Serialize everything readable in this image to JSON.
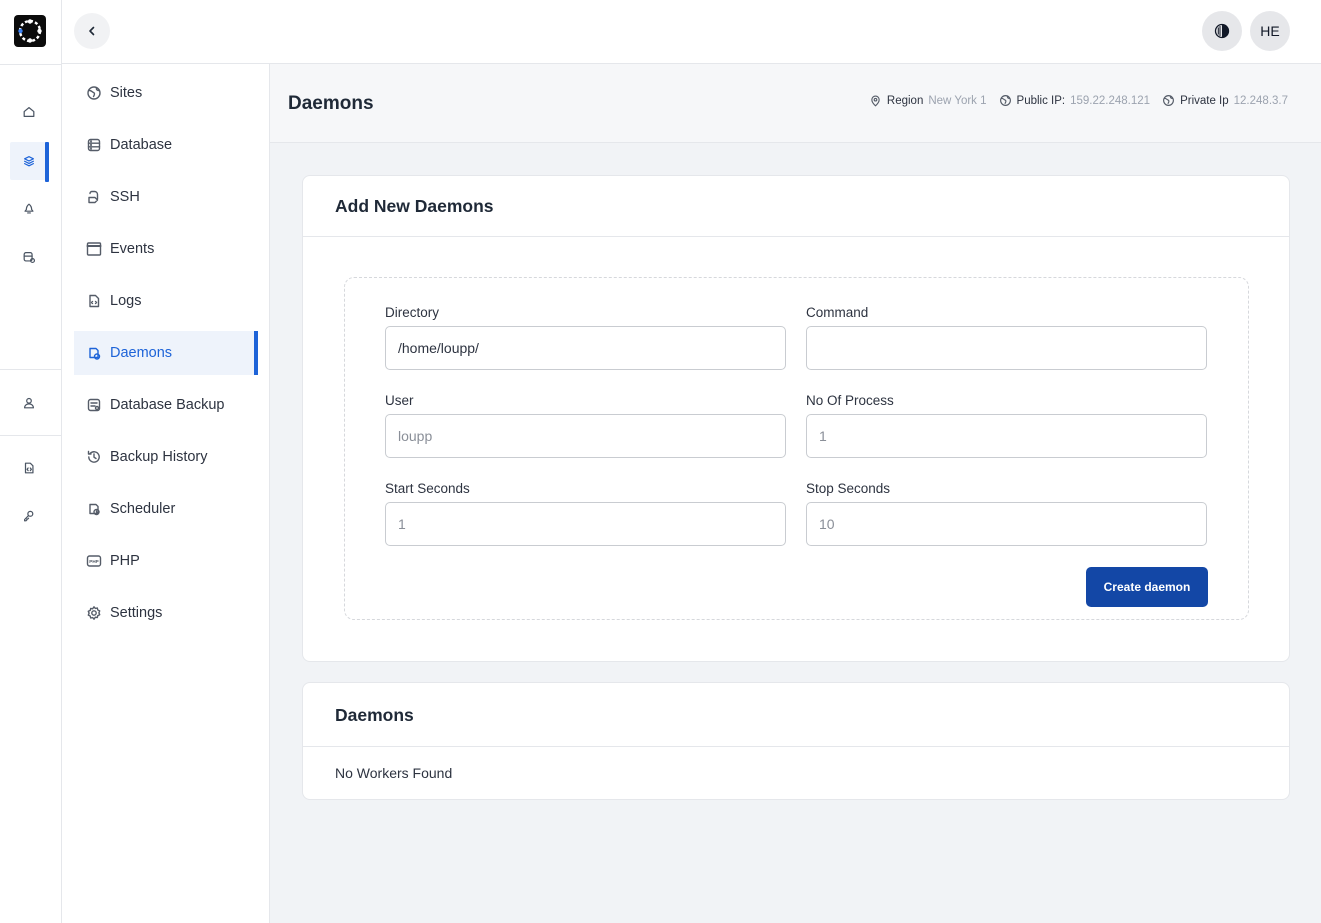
{
  "rail": {
    "logo_name": "app-logo",
    "top_icons": [
      "home-icon",
      "stack-icon",
      "rocket-icon",
      "database-settings-icon"
    ],
    "user_icons": [
      "user-icon"
    ],
    "bottom_icons": [
      "code-file-icon",
      "key-icon"
    ],
    "active_index": 1
  },
  "topbar": {
    "avatar_initials": "HE"
  },
  "sidebar": {
    "items": [
      {
        "label": "Sites",
        "icon": "globe-icon"
      },
      {
        "label": "Database",
        "icon": "database-icon"
      },
      {
        "label": "SSH",
        "icon": "terminal-icon"
      },
      {
        "label": "Events",
        "icon": "window-icon"
      },
      {
        "label": "Logs",
        "icon": "file-icon"
      },
      {
        "label": "Daemons",
        "icon": "daemon-icon"
      },
      {
        "label": "Database Backup",
        "icon": "backup-icon"
      },
      {
        "label": "Backup History",
        "icon": "history-icon"
      },
      {
        "label": "Scheduler",
        "icon": "clock-icon"
      },
      {
        "label": "PHP",
        "icon": "php-icon"
      },
      {
        "label": "Settings",
        "icon": "gear-icon"
      }
    ],
    "active": "Daemons"
  },
  "header": {
    "title": "Daemons",
    "region_label": "Region",
    "region_value": "New York 1",
    "public_ip_label": "Public IP:",
    "public_ip_value": "159.22.248.121",
    "private_ip_label": "Private Ip",
    "private_ip_value": "12.248.3.7"
  },
  "form": {
    "title": "Add New Daemons",
    "directory_label": "Directory",
    "directory_value": "/home/loupp/",
    "command_label": "Command",
    "command_value": "",
    "user_label": "User",
    "user_value": "loupp",
    "processes_label": "No Of Process",
    "processes_value": "1",
    "start_label": "Start Seconds",
    "start_value": "1",
    "stop_label": "Stop Seconds",
    "stop_value": "10",
    "submit_label": "Create daemon"
  },
  "list": {
    "title": "Daemons",
    "empty_text": "No Workers Found"
  },
  "colors": {
    "accent": "#1d63d8",
    "primary_button": "#1347a6",
    "background": "#f1f3f6"
  }
}
